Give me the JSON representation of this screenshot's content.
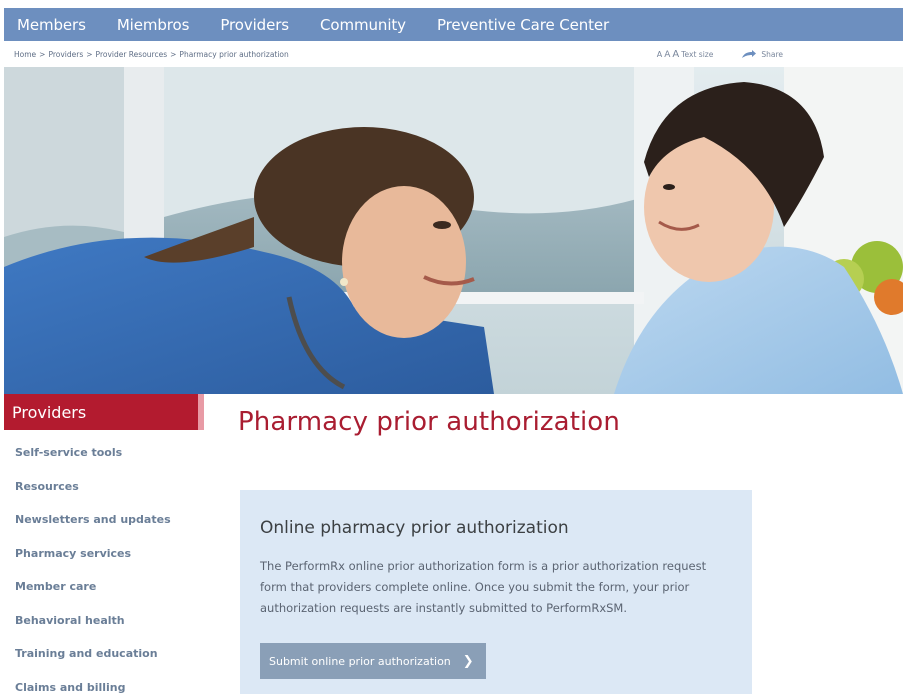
{
  "topnav": {
    "items": [
      "Members",
      "Miembros",
      "Providers",
      "Community",
      "Preventive Care Center"
    ]
  },
  "breadcrumb": {
    "items": [
      "Home",
      "Providers",
      "Provider Resources",
      "Pharmacy prior authorization"
    ],
    "separator": ">"
  },
  "tools": {
    "text_size_label": "Text size",
    "share_label": "Share"
  },
  "hero": {
    "description_icon": "photo-nurse-and-child"
  },
  "sidebar": {
    "heading": "Providers",
    "items": [
      "Self-service tools",
      "Resources",
      "Newsletters and updates",
      "Pharmacy services",
      "Member care",
      "Behavioral health",
      "Training and education",
      "Claims and billing"
    ]
  },
  "main": {
    "title": "Pharmacy prior authorization",
    "card": {
      "heading": "Online pharmacy prior authorization",
      "body": "The PerformRx online prior authorization form is a prior authorization request form that providers complete online. Once you submit the form, your prior authorization requests are instantly submitted to PerformRxSM.",
      "button_label": "Submit online prior authorization",
      "button_icon": "chevron-right-icon"
    }
  },
  "colors": {
    "nav_bg": "#6d8fbf",
    "brand_red": "#a91d31",
    "card_bg": "#dce8f5",
    "button_bg": "#8a9fb7",
    "sidebar_link": "#6a7e97"
  }
}
